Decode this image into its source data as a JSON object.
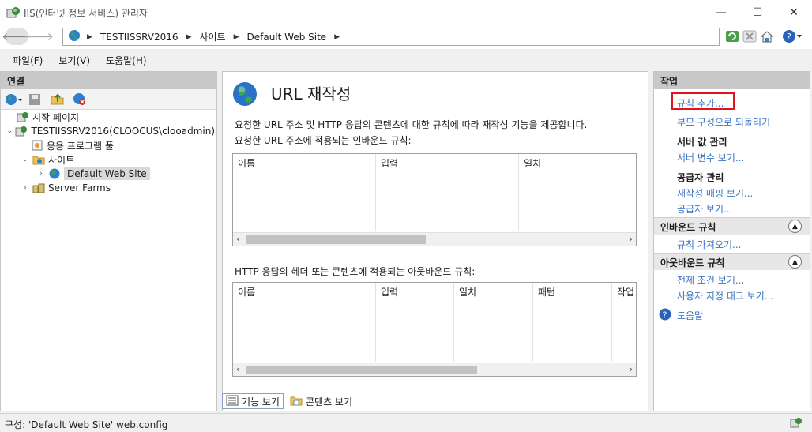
{
  "window": {
    "title": "IIS(인터넷 정보 서비스) 관리자",
    "minimize": "—",
    "maximize": "☐",
    "close": "✕"
  },
  "address": {
    "segments": [
      "TESTIISSRV2016",
      "사이트",
      "Default Web Site"
    ]
  },
  "menu": {
    "file": "파일(F)",
    "view": "보기(V)",
    "help": "도움말(H)"
  },
  "connections": {
    "header": "연결",
    "tree": [
      {
        "label": "시작 페이지"
      },
      {
        "label": "TESTIISSRV2016(CLOOCUS\\clooadmin)"
      },
      {
        "label": "응용 프로그램 풀"
      },
      {
        "label": "사이트"
      },
      {
        "label": "Default Web Site"
      },
      {
        "label": "Server Farms"
      }
    ]
  },
  "main": {
    "title": "URL 재작성",
    "description": "요청한 URL 주소 및 HTTP 응답의 콘텐츠에 대한 규칙에 따라 재작성 기능을 제공합니다.",
    "inbound_caption": "요청한 URL 주소에 적용되는 인바운드 규칙:",
    "inbound_columns": [
      "이름",
      "입력",
      "일치"
    ],
    "outbound_caption": "HTTP 응답의 헤더 또는 콘텐츠에 적용되는 아웃바운드 규칙:",
    "outbound_columns": [
      "이름",
      "입력",
      "일치",
      "패턴",
      "작업"
    ]
  },
  "view_tabs": {
    "features": "기능 보기",
    "content": "콘텐츠 보기"
  },
  "actions": {
    "header": "작업",
    "add_rule": "규칙 추가...",
    "revert_parent": "부모 구성으로 되돌리기",
    "server_vars_title": "서버 값 관리",
    "view_server_vars": "서버 변수 보기...",
    "providers_title": "공급자 관리",
    "view_rewrite_maps": "재작성 매핑 보기...",
    "view_providers": "공급자 보기...",
    "inbound_section": "인바운드 규칙",
    "import_rules": "규칙 가져오기...",
    "outbound_section": "아웃바운드 규칙",
    "view_preconditions": "전제 조건 보기...",
    "view_custom_tags": "사용자 지정 태그 보기...",
    "help": "도움말"
  },
  "status": {
    "text": "구성: 'Default Web Site' web.config"
  },
  "colors": {
    "link": "#3a74c2",
    "highlight": "#e0141e"
  }
}
